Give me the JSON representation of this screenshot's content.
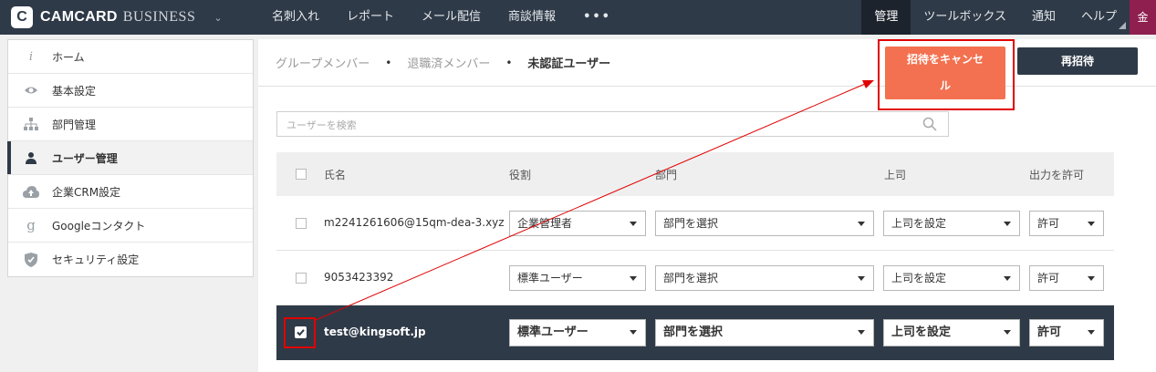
{
  "app": {
    "logo_letter": "C",
    "brand": "CAMCARD",
    "brand_suffix": "BUSINESS"
  },
  "nav": {
    "items": [
      "名刺入れ",
      "レポート",
      "メール配信",
      "商談情報",
      "•••"
    ],
    "right": [
      "管理",
      "ツールボックス",
      "通知",
      "ヘルプ"
    ],
    "avatar": "金"
  },
  "sidebar": {
    "items": [
      {
        "label": "ホーム",
        "icon": "info-icon"
      },
      {
        "label": "基本設定",
        "icon": "eye-icon"
      },
      {
        "label": "部門管理",
        "icon": "org-chart-icon"
      },
      {
        "label": "ユーザー管理",
        "icon": "user-icon",
        "active": true
      },
      {
        "label": "企業CRM設定",
        "icon": "cloud-upload-icon"
      },
      {
        "label": "Googleコンタクト",
        "icon": "google-icon"
      },
      {
        "label": "セキュリティ設定",
        "icon": "shield-icon"
      }
    ]
  },
  "tabs": [
    "グループメンバー",
    "退職済メンバー",
    "未認証ユーザー"
  ],
  "buttons": {
    "cancel_invite_line1": "招待をキャンセ",
    "cancel_invite_line2": "ル",
    "reinvite": "再招待"
  },
  "search": {
    "placeholder": "ユーザーを検索"
  },
  "table": {
    "headers": [
      "氏名",
      "役割",
      "部門",
      "上司",
      "出力を許可"
    ],
    "rows": [
      {
        "name": "m2241261606@15qm-dea-3.xyz",
        "role": "企業管理者",
        "dept": "部門を選択",
        "boss": "上司を設定",
        "export": "許可",
        "checked": false
      },
      {
        "name": "9053423392",
        "role": "標準ユーザー",
        "dept": "部門を選択",
        "boss": "上司を設定",
        "export": "許可",
        "checked": false
      },
      {
        "name": "test@kingsoft.jp",
        "role": "標準ユーザー",
        "dept": "部門を選択",
        "boss": "上司を設定",
        "export": "許可",
        "checked": true
      }
    ]
  },
  "colors": {
    "topbar": "#2f3a48",
    "accent_orange": "#f37150",
    "annotation_red": "#e00000",
    "avatar": "#8e1f4f"
  }
}
